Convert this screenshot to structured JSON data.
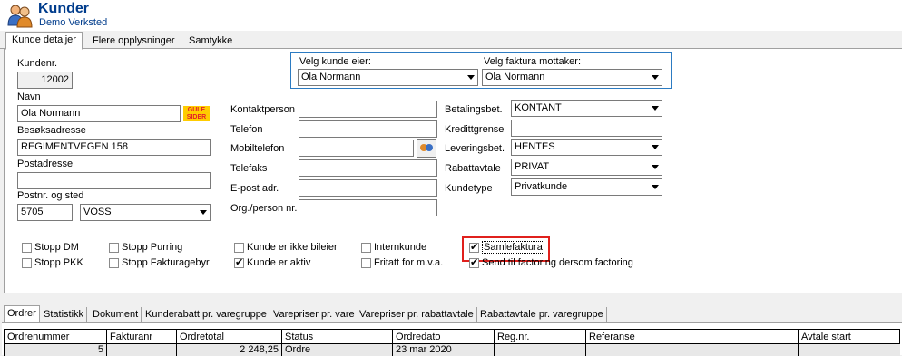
{
  "app": {
    "title": "Kunder",
    "subtitle": "Demo Verksted",
    "icon": "users-icon"
  },
  "tabs": [
    "Kunde detaljer",
    "Flere opplysninger",
    "Samtykke"
  ],
  "customer": {
    "kundenr_label": "Kundenr.",
    "kundenr": "12002",
    "navn_label": "Navn",
    "navn": "Ola Normann",
    "gule_sider": [
      "GULE",
      "SIDER"
    ],
    "besok_label": "Besøksadresse",
    "besok": "REGIMENTVEGEN 158",
    "post_label": "Postadresse",
    "post": "",
    "postnr_label": "Postnr. og sted",
    "postnr": "5705",
    "sted": "VOSS"
  },
  "owner_box": {
    "eier_label": "Velg kunde eier:",
    "eier": "Ola Normann",
    "mottaker_label": "Velg faktura mottaker:",
    "mottaker": "Ola Normann"
  },
  "contact": {
    "kontaktperson_label": "Kontaktperson",
    "telefon_label": "Telefon",
    "mobil_label": "Mobiltelefon",
    "telefaks_label": "Telefaks",
    "epost_label": "E-post adr.",
    "orgnr_label": "Org./person nr."
  },
  "terms": {
    "betaling_label": "Betalingsbet.",
    "betaling": "KONTANT",
    "kreditt_label": "Kredittgrense",
    "kreditt": "",
    "levering_label": "Leveringsbet.",
    "levering": "HENTES",
    "rabatt_label": "Rabattavtale",
    "rabatt": "PRIVAT",
    "kundetype_label": "Kundetype",
    "kundetype": "Privatkunde"
  },
  "checkboxes": {
    "stopp_dm": "Stopp DM",
    "stopp_pkk": "Stopp PKK",
    "stopp_purring": "Stopp Purring",
    "stopp_fakturagebyr": "Stopp Fakturagebyr",
    "ikke_bileier": "Kunde er ikke bileier",
    "aktiv": "Kunde er aktiv",
    "internkunde": "Internkunde",
    "fritatt_mva": "Fritatt for m.v.a.",
    "samlefaktura": "Samlefaktura",
    "factoring": "Send til factoring dersom factoring"
  },
  "highlight_color": "#e0201c",
  "lower_tabs": [
    "Ordrer",
    "Statistikk",
    "Dokument",
    "Kunderabatt pr. varegruppe",
    "Varepriser pr. vare",
    "Varepriser pr. rabattavtale",
    "Rabattavtale pr. varegruppe"
  ],
  "orders": {
    "columns": [
      "Ordrenummer",
      "Fakturanr",
      "Ordretotal",
      "Status",
      "Ordredato",
      "Reg.nr.",
      "Referanse",
      "Avtale start"
    ],
    "rows": [
      [
        "5",
        "",
        "2 248,25",
        "Ordre",
        "23 mar 2020",
        "",
        "",
        ""
      ]
    ]
  }
}
